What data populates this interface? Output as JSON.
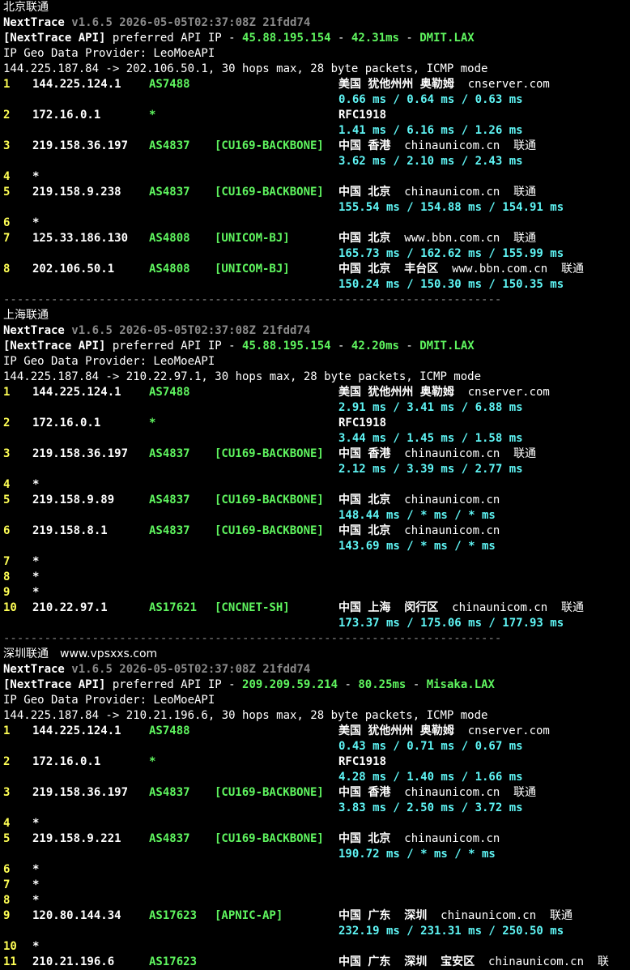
{
  "blocks": [
    {
      "title": "北京联通",
      "watermark": "",
      "header": {
        "app": "NextTrace",
        "version": "v1.6.5 2026-05-05T02:37:08Z 21fdd74",
        "api_label": "[NextTrace API]",
        "api_text": "preferred API IP -",
        "api_ip": "45.88.195.154",
        "api_dash1": "-",
        "api_ms": "42.31ms",
        "api_dash2": "-",
        "api_node": "DMIT.LAX",
        "geo_provider": "IP Geo Data Provider: LeoMoeAPI",
        "route": "144.225.187.84 -> 202.106.50.1, 30 hops max, 28 byte packets, ICMP mode"
      },
      "hops": [
        {
          "n": "1",
          "ip": "144.225.124.1",
          "asn": "AS7488",
          "tag": "",
          "geo": "美国 犹他州州 奥勒姆",
          "domain": "cnserver.com",
          "isp": "",
          "rtt": "0.66 ms / 0.64 ms / 0.63 ms"
        },
        {
          "n": "2",
          "ip": "172.16.0.1",
          "asn": "*",
          "tag": "",
          "geo": "RFC1918",
          "domain": "",
          "isp": "",
          "rtt": "1.41 ms / 6.16 ms / 1.26 ms"
        },
        {
          "n": "3",
          "ip": "219.158.36.197",
          "asn": "AS4837",
          "tag": "[CU169-BACKBONE]",
          "geo": "中国 香港",
          "domain": "chinaunicom.cn",
          "isp": "联通",
          "rtt": "3.62 ms / 2.10 ms / 2.43 ms"
        },
        {
          "n": "4",
          "ip": "*",
          "asn": "",
          "tag": "",
          "geo": "",
          "domain": "",
          "isp": "",
          "rtt": ""
        },
        {
          "n": "5",
          "ip": "219.158.9.238",
          "asn": "AS4837",
          "tag": "[CU169-BACKBONE]",
          "geo": "中国 北京",
          "domain": "chinaunicom.cn",
          "isp": "联通",
          "rtt": "155.54 ms / 154.88 ms / 154.91 ms"
        },
        {
          "n": "6",
          "ip": "*",
          "asn": "",
          "tag": "",
          "geo": "",
          "domain": "",
          "isp": "",
          "rtt": ""
        },
        {
          "n": "7",
          "ip": "125.33.186.130",
          "asn": "AS4808",
          "tag": "[UNICOM-BJ]",
          "geo": "中国 北京",
          "domain": "www.bbn.com.cn",
          "isp": "联通",
          "rtt": "165.73 ms / 162.62 ms / 155.99 ms"
        },
        {
          "n": "8",
          "ip": "202.106.50.1",
          "asn": "AS4808",
          "tag": "[UNICOM-BJ]",
          "geo": "中国 北京  丰台区",
          "domain": "www.bbn.com.cn",
          "isp": "联通",
          "rtt": "150.24 ms / 150.30 ms / 150.35 ms"
        }
      ],
      "separator": "-------------------------------------------------------------------------"
    },
    {
      "title": "上海联通",
      "watermark": "",
      "header": {
        "app": "NextTrace",
        "version": "v1.6.5 2026-05-05T02:37:08Z 21fdd74",
        "api_label": "[NextTrace API]",
        "api_text": "preferred API IP -",
        "api_ip": "45.88.195.154",
        "api_dash1": "-",
        "api_ms": "42.20ms",
        "api_dash2": "-",
        "api_node": "DMIT.LAX",
        "geo_provider": "IP Geo Data Provider: LeoMoeAPI",
        "route": "144.225.187.84 -> 210.22.97.1, 30 hops max, 28 byte packets, ICMP mode"
      },
      "hops": [
        {
          "n": "1",
          "ip": "144.225.124.1",
          "asn": "AS7488",
          "tag": "",
          "geo": "美国 犹他州州 奥勒姆",
          "domain": "cnserver.com",
          "isp": "",
          "rtt": "2.91 ms / 3.41 ms / 6.88 ms"
        },
        {
          "n": "2",
          "ip": "172.16.0.1",
          "asn": "*",
          "tag": "",
          "geo": "RFC1918",
          "domain": "",
          "isp": "",
          "rtt": "3.44 ms / 1.45 ms / 1.58 ms"
        },
        {
          "n": "3",
          "ip": "219.158.36.197",
          "asn": "AS4837",
          "tag": "[CU169-BACKBONE]",
          "geo": "中国 香港",
          "domain": "chinaunicom.cn",
          "isp": "联通",
          "rtt": "2.12 ms / 3.39 ms / 2.77 ms"
        },
        {
          "n": "4",
          "ip": "*",
          "asn": "",
          "tag": "",
          "geo": "",
          "domain": "",
          "isp": "",
          "rtt": ""
        },
        {
          "n": "5",
          "ip": "219.158.9.89",
          "asn": "AS4837",
          "tag": "[CU169-BACKBONE]",
          "geo": "中国 北京",
          "domain": "chinaunicom.cn",
          "isp": "",
          "rtt": "148.44 ms / * ms / * ms"
        },
        {
          "n": "6",
          "ip": "219.158.8.1",
          "asn": "AS4837",
          "tag": "[CU169-BACKBONE]",
          "geo": "中国 北京",
          "domain": "chinaunicom.cn",
          "isp": "",
          "rtt": "143.69 ms / * ms / * ms"
        },
        {
          "n": "7",
          "ip": "*",
          "asn": "",
          "tag": "",
          "geo": "",
          "domain": "",
          "isp": "",
          "rtt": ""
        },
        {
          "n": "8",
          "ip": "*",
          "asn": "",
          "tag": "",
          "geo": "",
          "domain": "",
          "isp": "",
          "rtt": ""
        },
        {
          "n": "9",
          "ip": "*",
          "asn": "",
          "tag": "",
          "geo": "",
          "domain": "",
          "isp": "",
          "rtt": ""
        },
        {
          "n": "10",
          "ip": "210.22.97.1",
          "asn": "AS17621",
          "tag": "[CNCNET-SH]",
          "geo": "中国 上海  闵行区",
          "domain": "chinaunicom.cn",
          "isp": "联通",
          "rtt": "173.37 ms / 175.06 ms / 177.93 ms"
        }
      ],
      "separator": "-------------------------------------------------------------------------"
    },
    {
      "title": "深圳联通",
      "watermark": "www.vpsxxs.com",
      "header": {
        "app": "NextTrace",
        "version": "v1.6.5 2026-05-05T02:37:08Z 21fdd74",
        "api_label": "[NextTrace API]",
        "api_text": "preferred API IP -",
        "api_ip": "209.209.59.214",
        "api_dash1": "-",
        "api_ms": "80.25ms",
        "api_dash2": "-",
        "api_node": "Misaka.LAX",
        "geo_provider": "IP Geo Data Provider: LeoMoeAPI",
        "route": "144.225.187.84 -> 210.21.196.6, 30 hops max, 28 byte packets, ICMP mode"
      },
      "hops": [
        {
          "n": "1",
          "ip": "144.225.124.1",
          "asn": "AS7488",
          "tag": "",
          "geo": "美国 犹他州州 奥勒姆",
          "domain": "cnserver.com",
          "isp": "",
          "rtt": "0.43 ms / 0.71 ms / 0.67 ms"
        },
        {
          "n": "2",
          "ip": "172.16.0.1",
          "asn": "*",
          "tag": "",
          "geo": "RFC1918",
          "domain": "",
          "isp": "",
          "rtt": "4.28 ms / 1.40 ms / 1.66 ms"
        },
        {
          "n": "3",
          "ip": "219.158.36.197",
          "asn": "AS4837",
          "tag": "[CU169-BACKBONE]",
          "geo": "中国 香港",
          "domain": "chinaunicom.cn",
          "isp": "联通",
          "rtt": "3.83 ms / 2.50 ms / 3.72 ms"
        },
        {
          "n": "4",
          "ip": "*",
          "asn": "",
          "tag": "",
          "geo": "",
          "domain": "",
          "isp": "",
          "rtt": ""
        },
        {
          "n": "5",
          "ip": "219.158.9.221",
          "asn": "AS4837",
          "tag": "[CU169-BACKBONE]",
          "geo": "中国 北京",
          "domain": "chinaunicom.cn",
          "isp": "",
          "rtt": "190.72 ms / * ms / * ms"
        },
        {
          "n": "6",
          "ip": "*",
          "asn": "",
          "tag": "",
          "geo": "",
          "domain": "",
          "isp": "",
          "rtt": ""
        },
        {
          "n": "7",
          "ip": "*",
          "asn": "",
          "tag": "",
          "geo": "",
          "domain": "",
          "isp": "",
          "rtt": ""
        },
        {
          "n": "8",
          "ip": "*",
          "asn": "",
          "tag": "",
          "geo": "",
          "domain": "",
          "isp": "",
          "rtt": ""
        },
        {
          "n": "9",
          "ip": "120.80.144.34",
          "asn": "AS17623",
          "tag": "[APNIC-AP]",
          "geo": "中国 广东  深圳",
          "domain": "chinaunicom.cn",
          "isp": "联通",
          "rtt": "232.19 ms / 231.31 ms / 250.50 ms"
        },
        {
          "n": "10",
          "ip": "*",
          "asn": "",
          "tag": "",
          "geo": "",
          "domain": "",
          "isp": "",
          "rtt": ""
        },
        {
          "n": "11",
          "ip": "210.21.196.6",
          "asn": "AS17623",
          "tag": "",
          "geo": "中国 广东  深圳  宝安区",
          "domain": "chinaunicom.cn",
          "isp": "联",
          "rtt": ""
        }
      ],
      "separator": ""
    }
  ]
}
